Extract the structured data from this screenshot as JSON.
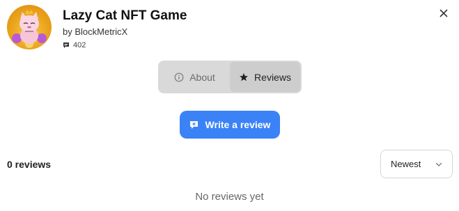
{
  "app": {
    "title": "Lazy Cat NFT Game",
    "author": "by BlockMetricX",
    "comment_count": "402",
    "avatar_icon": "lazy-cat-logo"
  },
  "tabs": [
    {
      "label": "About",
      "icon": "info-icon",
      "selected": false
    },
    {
      "label": "Reviews",
      "icon": "star-icon",
      "selected": true
    }
  ],
  "write_review": {
    "label": "Write a review",
    "icon": "comment-plus-icon"
  },
  "reviews": {
    "count_label": "0 reviews",
    "sort": {
      "selected": "Newest"
    },
    "empty_message": "No reviews yet"
  },
  "colors": {
    "accent": "#3b82f6",
    "tab_track": "#d9d9d9",
    "tab_selected": "#cdcdcd"
  }
}
